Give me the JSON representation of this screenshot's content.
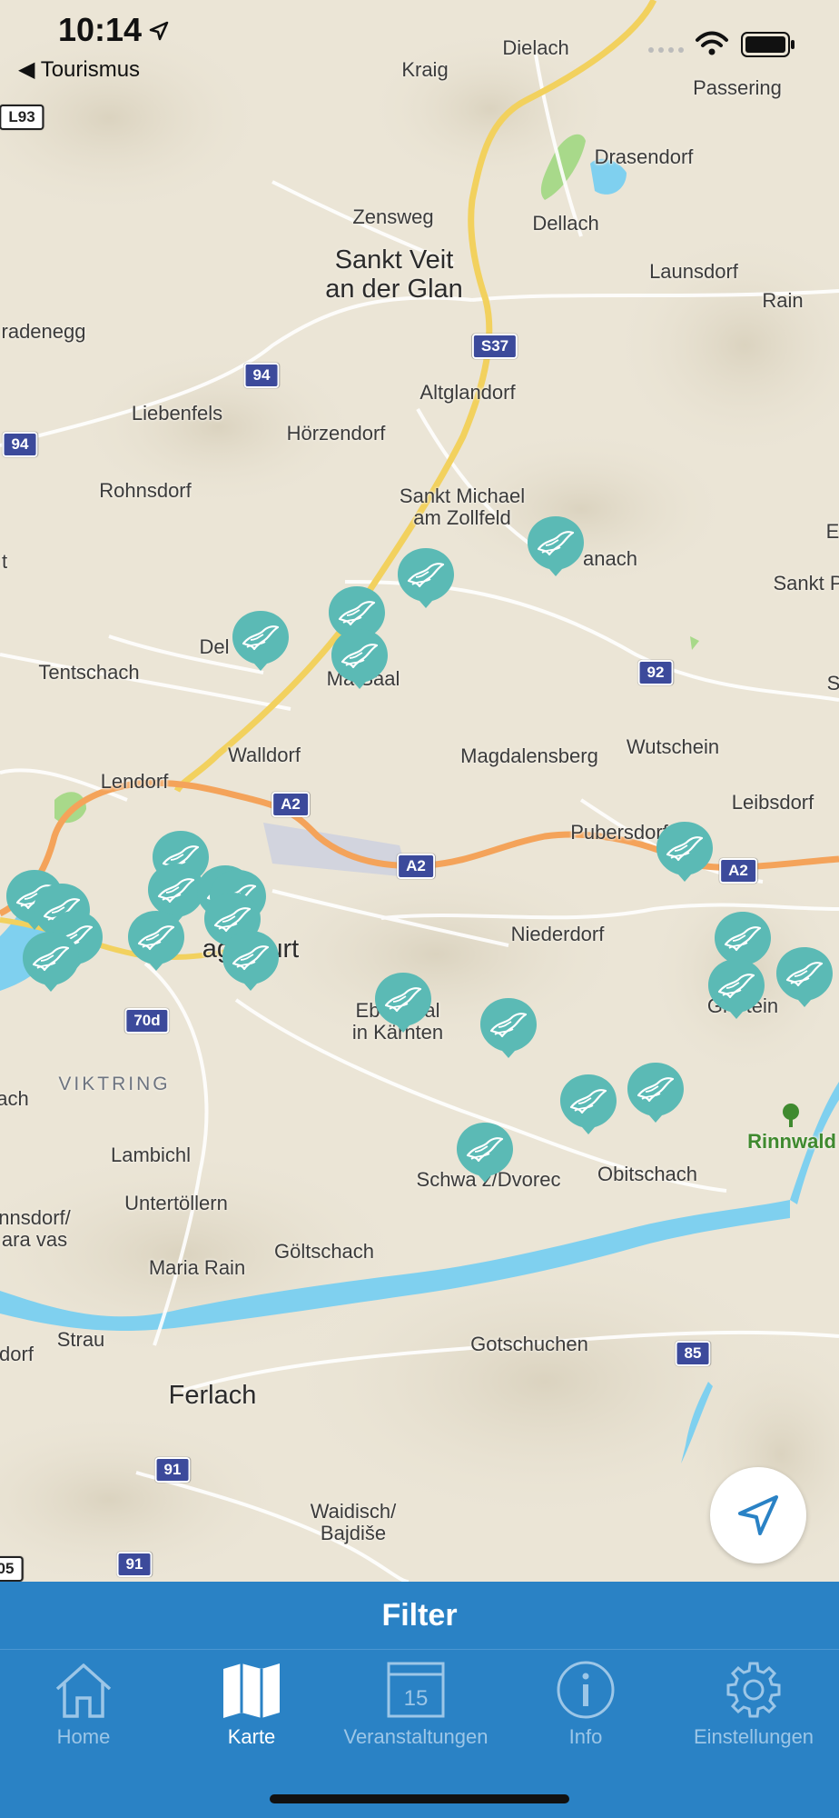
{
  "status_bar": {
    "time": "10:14",
    "back_label": "◀ Tourismus"
  },
  "map": {
    "places": {
      "dielach": "Dielach",
      "kraig": "Kraig",
      "passering": "Passering",
      "drasendorf": "Drasendorf",
      "zensweg": "Zensweg",
      "dellach": "Dellach",
      "sankt_veit": "Sankt Veit\nan der Glan",
      "launsdorf": "Launsdorf",
      "rain": "Rain",
      "radenegg": "radenegg",
      "altglandorf": "Altglandorf",
      "liebenfels": "Liebenfels",
      "hoerzendorf": "Hörzendorf",
      "rohnsdorf": "Rohnsdorf",
      "sankt_michael": "Sankt Michael\nam Zollfeld",
      "anach": "anach",
      "e_edge": "E",
      "t_edge": "t",
      "sankt_p": "Sankt P",
      "del": "Del",
      "tentschach": "Tentschach",
      "maria_saal": "Ma   Saal",
      "s_edge": "S",
      "walldorf": "Walldorf",
      "magdalensberg": "Magdalensberg",
      "wutschein": "Wutschein",
      "lendorf": "Lendorf",
      "leibsdorf": "Leibsdorf",
      "pubersdorf": "Pubersdorf",
      "niederdorf": "Niederdorf",
      "klagenfurt": "agenfurt",
      "ebenthal": "Eb        al\nin Kärnten",
      "grafenstein": "Gra        tein",
      "viktring": "VIKTRING",
      "ach_edge": "ach",
      "lambichl": "Lambichl",
      "rinnwald": "Rinnwald",
      "untertoellern": "Untertöllern",
      "schwarz": "Schwa   z/Dvorec",
      "obitschach": "Obitschach",
      "nnsdorf": "nnsdorf/\nara vas",
      "goeltschach": "Göltschach",
      "maria_rain": "Maria Rain",
      "strau": "Strau",
      "dorf_edge": "dorf",
      "gotschuchen": "Gotschuchen",
      "ferlach": "Ferlach",
      "waidisch": "Waidisch/\nBajdiše"
    },
    "shields": {
      "l93": "L93",
      "r94a": "94",
      "r94b": "94",
      "s37": "S37",
      "r92": "92",
      "a2a": "A2",
      "a2b": "A2",
      "a2c": "A2",
      "r70d": "70d",
      "r85": "85",
      "r91a": "91",
      "r91b": "91",
      "r05": "05"
    }
  },
  "filter_label": "Filter",
  "tabs": [
    {
      "label": "Home",
      "icon": "home-icon"
    },
    {
      "label": "Karte",
      "icon": "map-icon"
    },
    {
      "label": "Veranstaltungen",
      "icon": "calendar-icon",
      "day": "15"
    },
    {
      "label": "Info",
      "icon": "info-icon"
    },
    {
      "label": "Einstellungen",
      "icon": "gear-icon"
    }
  ],
  "colors": {
    "marker": "#5bbab5",
    "tabbar": "#2a82c5",
    "water": "#7fd0ef",
    "highway": "#f4a35a",
    "freeway_yellow": "#f2d15e"
  }
}
